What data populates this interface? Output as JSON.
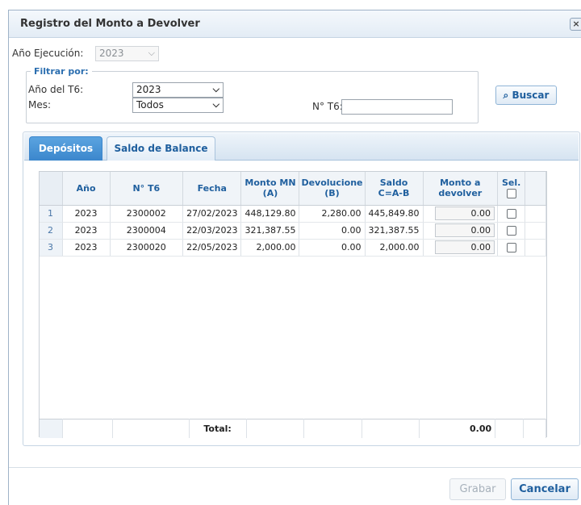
{
  "window": {
    "title": "Registro del Monto a Devolver",
    "close_glyph": "×"
  },
  "ejecucion": {
    "label": "Año Ejecución:",
    "value": "2023"
  },
  "filter": {
    "legend": "Filtrar por:",
    "anio_label": "Año del T6:",
    "anio_value": "2023",
    "mes_label": "Mes:",
    "mes_value": "Todos",
    "nro_label": "N° T6:",
    "nro_value": ""
  },
  "buscar": {
    "label": "Buscar",
    "icon": "search-icon"
  },
  "tabs": [
    {
      "label": "Depósitos",
      "active": true
    },
    {
      "label": "Saldo de Balance",
      "active": false
    }
  ],
  "grid": {
    "headers": {
      "anio": "Año",
      "nro_t6": "N° T6",
      "fecha": "Fecha",
      "monto_mn": "Monto MN",
      "monto_mn_sub": "(A)",
      "devoluciones": "Devolucione",
      "devoluciones_sub": "(B)",
      "saldo": "Saldo",
      "saldo_sub": "C=A-B",
      "monto_devolver": "Monto a",
      "monto_devolver_sub": "devolver",
      "sel": "Sel."
    },
    "rows": [
      {
        "n": "1",
        "anio": "2023",
        "nro_t6": "2300002",
        "fecha": "27/02/2023",
        "monto_mn": "448,129.80",
        "devoluciones": "2,280.00",
        "saldo": "445,849.80",
        "monto_devolver": "0.00"
      },
      {
        "n": "2",
        "anio": "2023",
        "nro_t6": "2300004",
        "fecha": "22/03/2023",
        "monto_mn": "321,387.55",
        "devoluciones": "0.00",
        "saldo": "321,387.55",
        "monto_devolver": "0.00"
      },
      {
        "n": "3",
        "anio": "2023",
        "nro_t6": "2300020",
        "fecha": "22/05/2023",
        "monto_mn": "2,000.00",
        "devoluciones": "0.00",
        "saldo": "2,000.00",
        "monto_devolver": "0.00"
      }
    ],
    "footer": {
      "total_label": "Total:",
      "total_value": "0.00"
    }
  },
  "actions": {
    "grabar": "Grabar",
    "cancelar": "Cancelar"
  },
  "colors": {
    "accent": "#2c6fb0",
    "tab_active": "#3b86cc"
  }
}
